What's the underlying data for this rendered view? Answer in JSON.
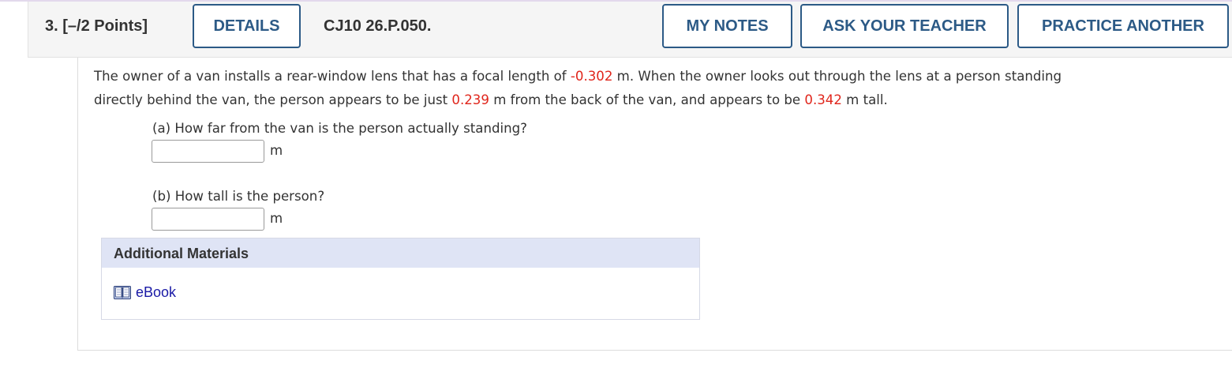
{
  "header": {
    "question_label": "3. [–/2 Points]",
    "details_label": "DETAILS",
    "question_code": "CJ10 26.P.050.",
    "my_notes_label": "MY NOTES",
    "ask_teacher_label": "ASK YOUR TEACHER",
    "practice_another_label": "PRACTICE ANOTHER"
  },
  "problem": {
    "line1_a": "The owner of a van installs a rear-window lens that has a focal length of ",
    "focal_length": "-0.302",
    "line1_b": " m. When the owner looks out through the lens at a person standing",
    "line2_a": "directly behind the van, the person appears to be just ",
    "image_distance": "0.239",
    "line2_b": " m from the back of the van, and appears to be ",
    "image_height": "0.342",
    "line2_c": " m tall.",
    "highlight_color": "#e0261c"
  },
  "parts": {
    "a": {
      "question": "(a) How far from the van is the person actually standing?",
      "value": "",
      "unit": "m"
    },
    "b": {
      "question": "(b) How tall is the person?",
      "value": "",
      "unit": "m"
    }
  },
  "materials": {
    "title": "Additional Materials",
    "ebook_label": "eBook",
    "ebook_icon": "book-icon"
  },
  "colors": {
    "button_border": "#2c5a86",
    "link": "#1a1aa6",
    "materials_header_bg": "#dfe4f5"
  }
}
